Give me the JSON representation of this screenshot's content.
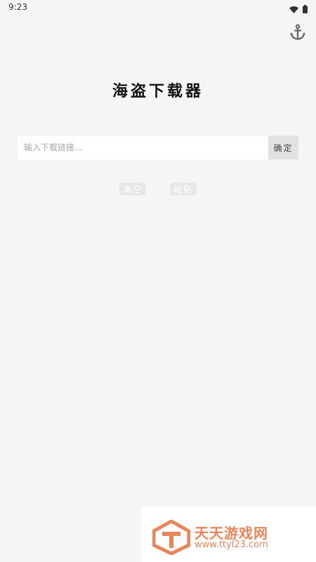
{
  "status_bar": {
    "time": "9:23",
    "icons": [
      "wifi-icon",
      "battery-icon"
    ]
  },
  "header": {
    "anchor_icon": "anchor-icon"
  },
  "app": {
    "title": "海盗下载器"
  },
  "url_input": {
    "placeholder": "输入下载链接...",
    "value": ""
  },
  "buttons": {
    "confirm": "确定",
    "clear": "清空",
    "paste": "粘贴"
  },
  "watermark": {
    "name": "天天游戏网",
    "url": "www.ttyl23.com",
    "color": "#e9855a"
  },
  "colors": {
    "background": "#f5f5f5",
    "input_bg": "#ffffff",
    "confirm_bg": "#e2e2e2"
  }
}
